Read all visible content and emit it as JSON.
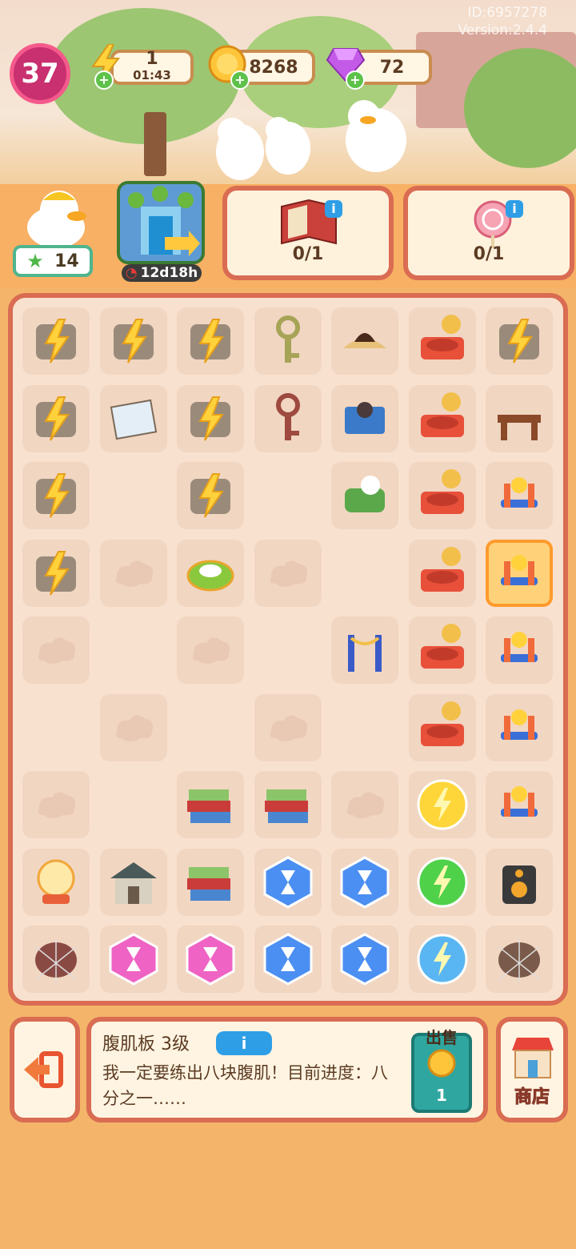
{
  "meta": {
    "id_text": "ID:6957278",
    "version_text": "Version:2.4.4"
  },
  "level": {
    "value": "37"
  },
  "energy": {
    "value": "1",
    "timer": "01:43",
    "icon": "lightning-icon"
  },
  "coins": {
    "value": "8268",
    "icon": "coin-icon"
  },
  "gems": {
    "value": "72",
    "icon": "gem-icon"
  },
  "character": {
    "stars": "14"
  },
  "event": {
    "timer": "12d18h"
  },
  "quests": [
    {
      "name": "book-quest",
      "progress": "0/1"
    },
    {
      "name": "lollipop-quest",
      "progress": "0/1"
    }
  ],
  "board": {
    "cols": 7,
    "rows": 9,
    "cells": [
      [
        "tv-locked",
        "painting-locked",
        "bag-locked",
        "key-green",
        "pirate-hat",
        "stage-locked",
        "bench-locked"
      ],
      [
        "film-locked",
        "photo",
        "bag-locked",
        "key-brown",
        "blue-book",
        "stage-locked",
        "bench"
      ],
      [
        "film-locked",
        "",
        "bag-locked",
        "",
        "scroll-bundle",
        "stage-building",
        "steering-toy"
      ],
      [
        "film-locked",
        "fog",
        "pillow-bag",
        "fog",
        "",
        "stage-building",
        "slide-toy"
      ],
      [
        "fog",
        "",
        "fog",
        "",
        "rope-barrier",
        "stage-building",
        "swing-toy"
      ],
      [
        "",
        "fog",
        "",
        "fog",
        "",
        "stage-building",
        "rocker-toy"
      ],
      [
        "fog",
        "",
        "book-stack",
        "book-stack",
        "fog",
        "energy-yellow",
        "exercise-bike"
      ],
      [
        "globe-lamp",
        "house",
        "book-stack",
        "hourglass-blue",
        "hourglass-blue",
        "energy-green",
        "speaker-box"
      ],
      [
        "cake-web",
        "hourglass-pink",
        "hourglass-pink",
        "hourglass-blue",
        "hourglass-blue",
        "energy-blue",
        "log-web"
      ]
    ],
    "selected": "slide-toy"
  },
  "item_info": {
    "title": "腹肌板 3级",
    "description": "我一定要练出八块腹肌！目前进度：八分之一……",
    "sell_label": "出售",
    "sell_price": "1"
  },
  "shop": {
    "label": "商店"
  },
  "colors": {
    "accent": "#d96c52",
    "board_bg": "#f8e1cf",
    "info_blue": "#2e9fe6"
  }
}
